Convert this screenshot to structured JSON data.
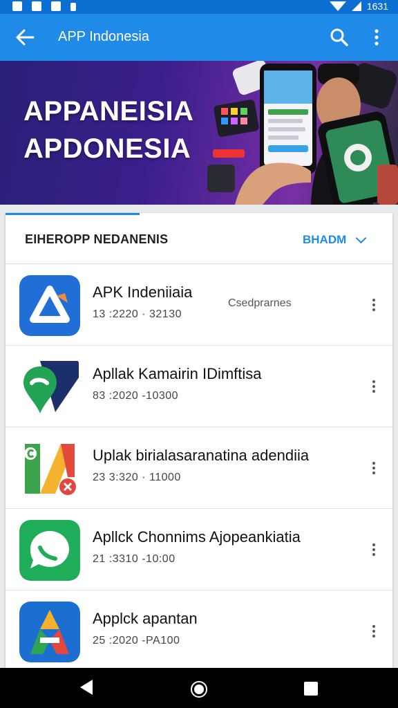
{
  "status_bar": {
    "time": "1631"
  },
  "app_bar": {
    "title": "APP Indonesia"
  },
  "banner": {
    "line1": "APPANEISIA",
    "line2": "APDONESIA"
  },
  "list_header": {
    "title": "EIHEROPP NEDANENIS",
    "sort_label": "BHADM"
  },
  "apps": [
    {
      "name": "APK Indeniiaia",
      "meta": "13 :2220 · 32130",
      "extra": "Csedprarnes"
    },
    {
      "name": "Apllak Kamairin IDimftisa",
      "meta": "83 :2020 -10300",
      "extra": ""
    },
    {
      "name": "Uplak birialasaranatina adendiia",
      "meta": "23 3:320 · 11000",
      "extra": ""
    },
    {
      "name": "Apllck Chonnims Ajopeankiatia",
      "meta": "21 :3310 -10:00",
      "extra": ""
    },
    {
      "name": "Applck apantan",
      "meta": "25 :2020 -PA100",
      "extra": ""
    }
  ],
  "colors": {
    "app_bar": "#1f8ae8",
    "status_bar": "#0a6fd1",
    "accent": "#1f8ae8"
  }
}
